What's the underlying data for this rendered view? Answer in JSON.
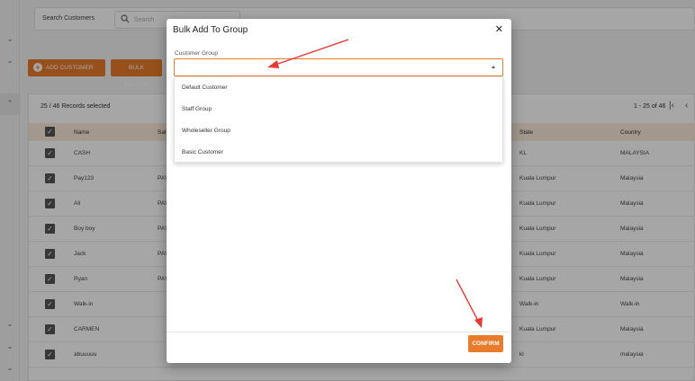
{
  "background": {
    "search": {
      "label": "Search Customers",
      "placeholder": "Search"
    },
    "buttons": {
      "add_customer": "ADD CUSTOMER",
      "bulk_upload": "BULK UPLOAD"
    },
    "records_selected": "25 / 46 Records selected",
    "pagination": "1 - 25 of 46",
    "columns": [
      "Name",
      "Sale",
      "State",
      "Country"
    ],
    "rows": [
      {
        "name": "CASH",
        "sale": "",
        "state": "KL",
        "country": "MALAYSIA"
      },
      {
        "name": "Pay123",
        "sale": "PAY",
        "state": "Kuala Lumpur",
        "country": "Malaysia"
      },
      {
        "name": "Ali",
        "sale": "PAY",
        "state": "Kuala Lumpur",
        "country": "Malaysia"
      },
      {
        "name": "Boy boy",
        "sale": "PAY",
        "state": "Kuala Lumpur",
        "country": "Malaysia"
      },
      {
        "name": "Jack",
        "sale": "PAY",
        "state": "Kuala Lumpur",
        "country": "Malaysia"
      },
      {
        "name": "Ryan",
        "sale": "PAY",
        "state": "Kuala Lumpur",
        "country": "Malaysia"
      },
      {
        "name": "Walk-in",
        "sale": "",
        "state": "Walk-in",
        "country": "Walk-in"
      },
      {
        "name": "CARMEN",
        "sale": "",
        "state": "Kuala Lumpur",
        "country": "Malaysia"
      },
      {
        "name": "abuuuuu",
        "sale": "",
        "state": "kl",
        "country": "malaysia"
      }
    ]
  },
  "modal": {
    "title": "Bulk Add To Group",
    "field_label": "Customer Group",
    "selected_value": "",
    "options": [
      "Default Customer",
      "Staff Group",
      "Wholeseller Group",
      "Basic Customer"
    ],
    "confirm_label": "CONFIRM"
  },
  "colors": {
    "accent": "#e87b2c",
    "arrow": "#e53935"
  }
}
